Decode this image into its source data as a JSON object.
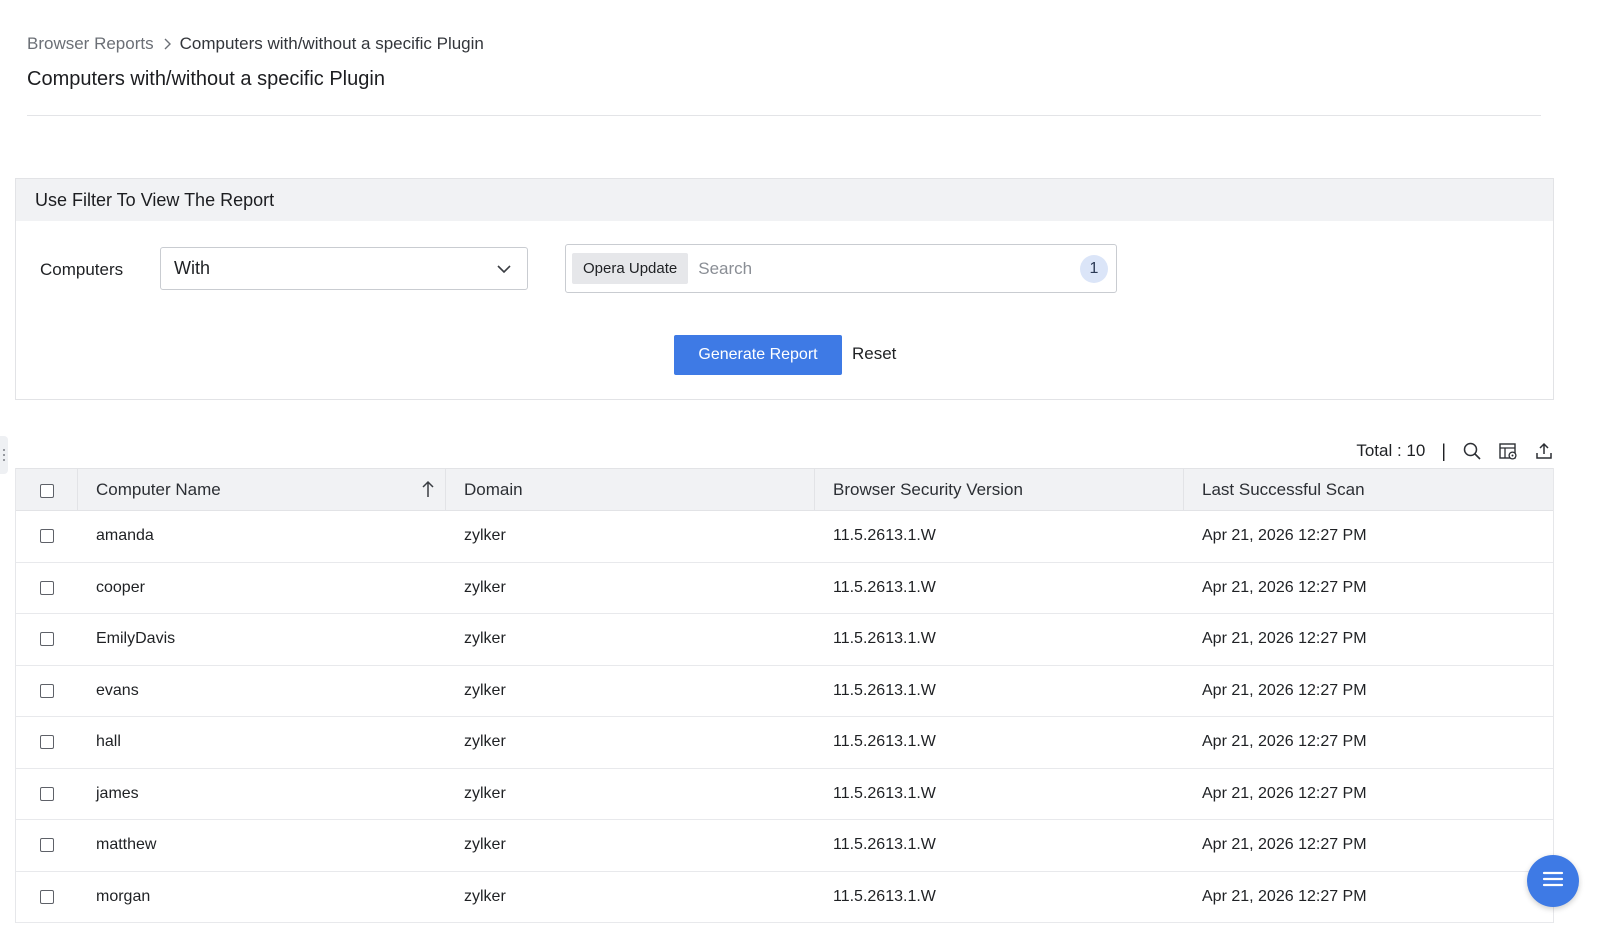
{
  "breadcrumb": {
    "root": "Browser Reports",
    "current": "Computers with/without a specific Plugin"
  },
  "page_title": "Computers with/without a specific Plugin",
  "filter": {
    "heading": "Use Filter To View The Report",
    "computers_label": "Computers",
    "selected_option": "With",
    "chip_label": "Opera Update",
    "search_placeholder": "Search",
    "selected_count": "1",
    "generate_label": "Generate Report",
    "reset_label": "Reset"
  },
  "toolbar": {
    "total_text": "Total : 10",
    "divider": "|",
    "icons": [
      "search-icon",
      "column-settings-icon",
      "export-icon"
    ]
  },
  "table": {
    "columns": [
      "Computer Name",
      "Domain",
      "Browser Security Version",
      "Last Successful Scan"
    ],
    "sort": {
      "column": "Computer Name",
      "direction": "ascending"
    },
    "rows": [
      {
        "name": "amanda",
        "domain": "zylker",
        "version": "11.5.2613.1.W",
        "scan": "Apr 21, 2026 12:27 PM"
      },
      {
        "name": "cooper",
        "domain": "zylker",
        "version": "11.5.2613.1.W",
        "scan": "Apr 21, 2026 12:27 PM"
      },
      {
        "name": "EmilyDavis",
        "domain": "zylker",
        "version": "11.5.2613.1.W",
        "scan": "Apr 21, 2026 12:27 PM"
      },
      {
        "name": "evans",
        "domain": "zylker",
        "version": "11.5.2613.1.W",
        "scan": "Apr 21, 2026 12:27 PM"
      },
      {
        "name": "hall",
        "domain": "zylker",
        "version": "11.5.2613.1.W",
        "scan": "Apr 21, 2026 12:27 PM"
      },
      {
        "name": "james",
        "domain": "zylker",
        "version": "11.5.2613.1.W",
        "scan": "Apr 21, 2026 12:27 PM"
      },
      {
        "name": "matthew",
        "domain": "zylker",
        "version": "11.5.2613.1.W",
        "scan": "Apr 21, 2026 12:27 PM"
      },
      {
        "name": "morgan",
        "domain": "zylker",
        "version": "11.5.2613.1.W",
        "scan": "Apr 21, 2026 12:27 PM"
      }
    ]
  },
  "colors": {
    "primary": "#3e7ae5",
    "header_bg": "#f1f2f4",
    "badge_bg": "#dbe5f8"
  }
}
